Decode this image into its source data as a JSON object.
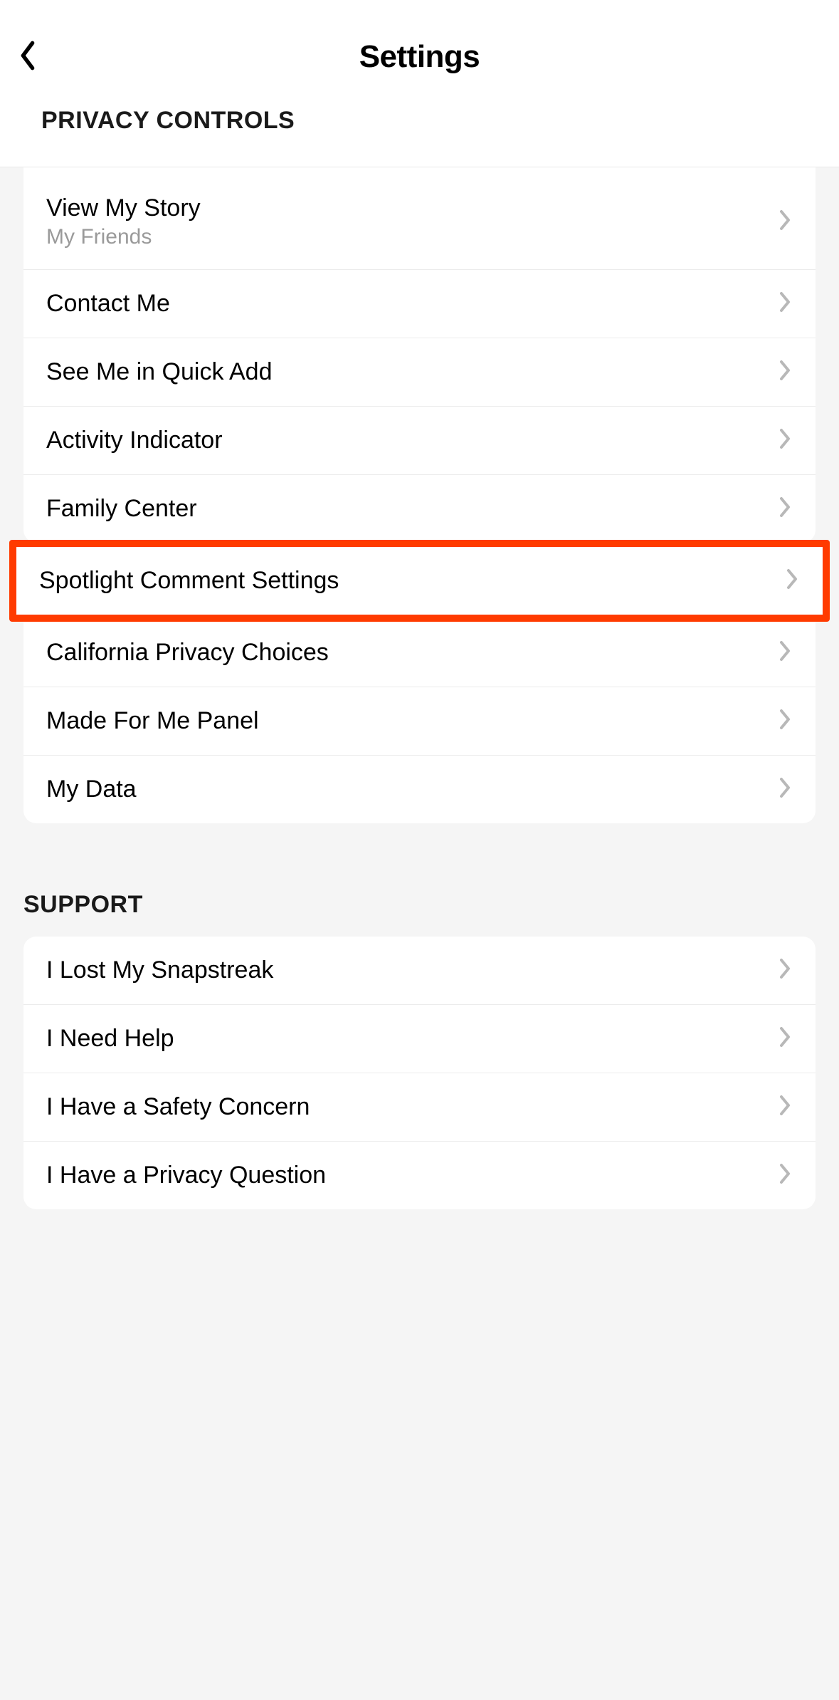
{
  "header": {
    "title": "Settings"
  },
  "sections": {
    "privacy": {
      "header": "PRIVACY CONTROLS",
      "items": [
        {
          "label": "View My Story",
          "sublabel": "My Friends"
        },
        {
          "label": "Contact Me"
        },
        {
          "label": "See Me in Quick Add"
        },
        {
          "label": "Activity Indicator"
        },
        {
          "label": "Family Center"
        },
        {
          "label": "Spotlight Comment Settings"
        },
        {
          "label": "California Privacy Choices"
        },
        {
          "label": "Made For Me Panel"
        },
        {
          "label": "My Data"
        }
      ]
    },
    "support": {
      "header": "SUPPORT",
      "items": [
        {
          "label": "I Lost My Snapstreak"
        },
        {
          "label": "I Need Help"
        },
        {
          "label": "I Have a Safety Concern"
        },
        {
          "label": "I Have a Privacy Question"
        }
      ]
    }
  }
}
